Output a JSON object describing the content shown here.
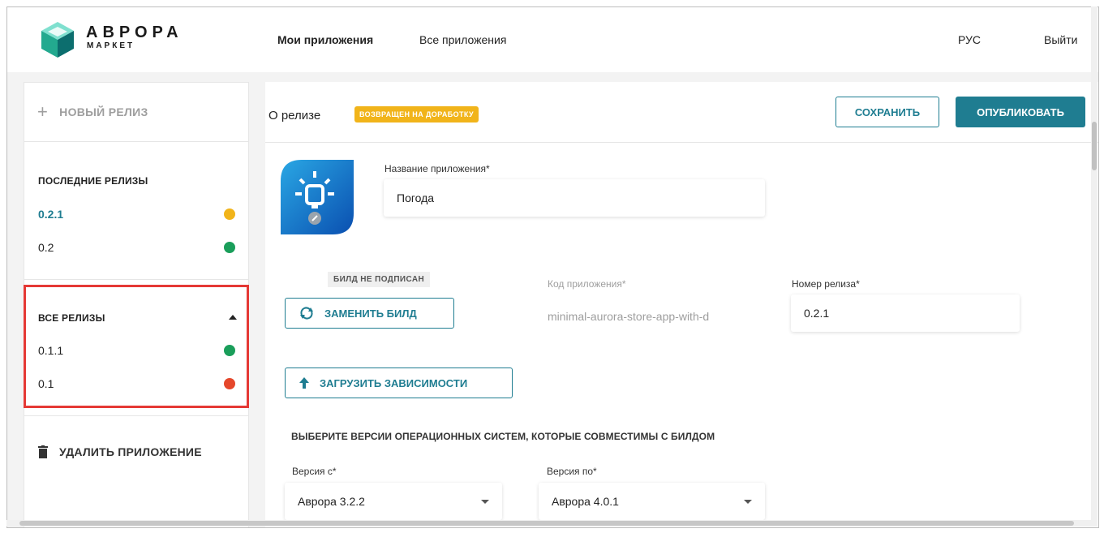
{
  "header": {
    "logo_title": "АВРОРА",
    "logo_sub": "МАРКЕТ",
    "nav": [
      "Мои приложения",
      "Все приложения"
    ],
    "lang": "РУС",
    "logout": "Выйти"
  },
  "sidebar": {
    "new_release": "НОВЫЙ РЕЛИЗ",
    "latest_heading": "ПОСЛЕДНИЕ РЕЛИЗЫ",
    "latest": [
      {
        "label": "0.2.1",
        "color": "#f1b41a"
      },
      {
        "label": "0.2",
        "color": "#1a9e5a"
      }
    ],
    "all_heading": "ВСЕ РЕЛИЗЫ",
    "all": [
      {
        "label": "0.1.1",
        "color": "#1a9e5a"
      },
      {
        "label": "0.1",
        "color": "#e5472b"
      }
    ],
    "delete_app": "УДАЛИТЬ ПРИЛОЖЕНИЕ"
  },
  "main": {
    "about": "О релизе",
    "badge": "ВОЗВРАЩЕН НА ДОРАБОТКУ",
    "save": "СОХРАНИТЬ",
    "publish": "ОПУБЛИКОВАТЬ",
    "app_name_label": "Название приложения*",
    "app_name_value": "Погода",
    "build_tag": "БИЛД НЕ ПОДПИСАН",
    "replace_build": "ЗАМЕНИТЬ БИЛД",
    "app_code_label": "Код приложения*",
    "app_code_value": "minimal-aurora-store-app-with-d",
    "release_number_label": "Номер релиза*",
    "release_number_value": "0.2.1",
    "upload_deps": "ЗАГРУЗИТЬ ЗАВИСИМОСТИ",
    "os_heading": "ВЫБЕРИТЕ ВЕРСИИ ОПЕРАЦИОННЫХ СИСТЕМ, КОТОРЫЕ СОВМЕСТИМЫ С БИЛДОМ",
    "version_from_label": "Версия с*",
    "version_from_value": "Аврора 3.2.2",
    "version_to_label": "Версия по*",
    "version_to_value": "Аврора 4.0.1"
  },
  "colors": {
    "accent": "#1f7d91",
    "badge": "#f1b41a",
    "highlight": "#e53935"
  }
}
